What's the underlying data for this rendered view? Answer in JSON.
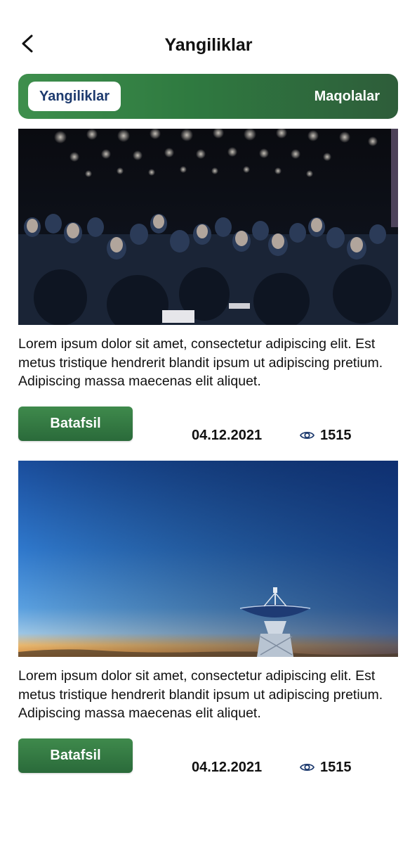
{
  "header": {
    "title": "Yangiliklar",
    "back_icon": "chevron-left-icon"
  },
  "tabs": [
    {
      "label": "Yangiliklar",
      "active": true
    },
    {
      "label": "Maqolalar",
      "active": false
    }
  ],
  "colors": {
    "tab_bar_start": "#3e8f4d",
    "tab_bar_end": "#2e5d3a",
    "button": "#2f7a40",
    "active_tab_text": "#1d3a6e"
  },
  "news": [
    {
      "image": "conference-audience-photo",
      "text": "Lorem ipsum dolor sit amet, consectetur adipiscing elit. Est metus tristique hendrerit blandit ipsum ut adipiscing pretium. Adipiscing massa maecenas elit aliquet.",
      "button_label": "Batafsil",
      "date": "04.12.2021",
      "views": "1515",
      "views_icon": "eye-icon"
    },
    {
      "image": "radio-telescope-sunset-photo",
      "text": "Lorem ipsum dolor sit amet, consectetur adipiscing elit. Est metus tristique hendrerit blandit ipsum ut adipiscing pretium. Adipiscing massa maecenas elit aliquet.",
      "button_label": "Batafsil",
      "date": "04.12.2021",
      "views": "1515",
      "views_icon": "eye-icon"
    }
  ]
}
